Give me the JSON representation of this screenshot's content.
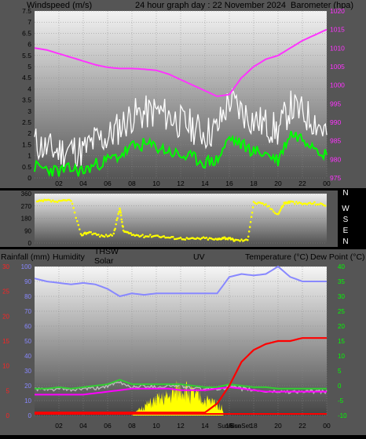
{
  "header": {
    "windspeed_label": "Windspeed (m/s)",
    "title": "24 hour graph day : 22 November 2024",
    "barometer_label": "Barometer (hpa)"
  },
  "wind_direction_labels": [
    "N",
    "W",
    "S",
    "E",
    "N"
  ],
  "bottom_header": {
    "rain_label": "Rainfall (mm)",
    "humidity_label": "Humidity",
    "thsw_label": "THSW",
    "solar_label": "Solar",
    "uv_label": "UV",
    "temp_label": "Temperature (°C)",
    "dew_label": "Dew Point (°C)"
  },
  "sunrise_label": "SunRise",
  "sunset_label": "SunSet",
  "colors": {
    "wind_gust": "#ffffff",
    "wind_avg": "#00ff00",
    "barometer": "#ff33ff",
    "direction": "#ffff00",
    "humidity": "#8888ff",
    "temperature": "#ff0000",
    "dewpoint": "#ff00ff",
    "thsw": "#bbbbbb",
    "solar": "#ffff00",
    "rain_axis": "#ff2222",
    "temp_axis": "#00ff00"
  },
  "chart_data": [
    {
      "type": "line",
      "title": "24 hour graph day : 22 November 2024",
      "xlabel": "",
      "x_ticks": [
        "02",
        "04",
        "06",
        "08",
        "10",
        "12",
        "14",
        "16",
        "18",
        "20",
        "22",
        "00"
      ],
      "ylabel_left": "Windspeed (m/s)",
      "ylim_left": [
        0,
        7.5
      ],
      "yticks_left": [
        "0",
        "0.5",
        "1",
        "1.5",
        "2",
        "2.5",
        "3",
        "3.5",
        "4",
        "4.5",
        "5",
        "5.5",
        "6",
        "6.5",
        "7",
        "7.5"
      ],
      "ylabel_right": "Barometer (hpa)",
      "ylim_right": [
        975,
        1020
      ],
      "yticks_right": [
        "975",
        "980",
        "985",
        "990",
        "995",
        "1000",
        "1005",
        "1010",
        "1015",
        "1020"
      ],
      "hours": [
        0,
        1,
        2,
        3,
        4,
        5,
        6,
        7,
        8,
        9,
        10,
        11,
        12,
        13,
        14,
        15,
        16,
        17,
        18,
        19,
        20,
        21,
        22,
        23,
        24
      ],
      "series": [
        {
          "axis": "left",
          "values": [
            1.6,
            1.3,
            1.2,
            1.3,
            1.2,
            1.7,
            1.8,
            2.3,
            2.8,
            2.9,
            3.0,
            2.8,
            2.5,
            2.3,
            2.0,
            2.2,
            3.5,
            3.0,
            2.6,
            2.4,
            2.1,
            3.2,
            2.9,
            2.6,
            2.0
          ]
        },
        {
          "axis": "left",
          "values": [
            0.5,
            0.4,
            0.3,
            0.4,
            0.3,
            0.6,
            0.8,
            1.0,
            1.4,
            1.5,
            1.4,
            1.2,
            1.0,
            0.9,
            0.7,
            0.8,
            1.8,
            1.5,
            1.2,
            1.1,
            0.8,
            2.0,
            1.8,
            1.5,
            1.0
          ]
        },
        {
          "axis": "right",
          "values": [
            1010,
            1009.5,
            1008.5,
            1007.5,
            1006.5,
            1005.5,
            1004.8,
            1004.5,
            1004.5,
            1004.3,
            1004,
            1003,
            1001.5,
            1000,
            998.5,
            997,
            997.5,
            1002,
            1005,
            1007,
            1008,
            1010,
            1012,
            1013.5,
            1015
          ]
        }
      ]
    },
    {
      "type": "scatter",
      "ylabel": "",
      "ylim": [
        0,
        360
      ],
      "yticks": [
        "0",
        "90",
        "180",
        "270",
        "360"
      ],
      "x_ticks": [
        "02",
        "04",
        "06",
        "08",
        "10",
        "12",
        "14",
        "16",
        "18",
        "20",
        "22",
        "00"
      ],
      "series": [
        {
          "values": [
            [
              0.2,
              300
            ],
            [
              1,
              310
            ],
            [
              2,
              300
            ],
            [
              3,
              315
            ],
            [
              3.8,
              60
            ],
            [
              4.5,
              80
            ],
            [
              5.5,
              50
            ],
            [
              6.5,
              60
            ],
            [
              7,
              260
            ],
            [
              7.3,
              90
            ],
            [
              8,
              60
            ],
            [
              9,
              50
            ],
            [
              10,
              55
            ],
            [
              11,
              40
            ],
            [
              12,
              35
            ],
            [
              13,
              30
            ],
            [
              14,
              35
            ],
            [
              15,
              25
            ],
            [
              15.5,
              40
            ],
            [
              16,
              30
            ],
            [
              16.5,
              20
            ],
            [
              17.5,
              20
            ],
            [
              18,
              295
            ],
            [
              19,
              280
            ],
            [
              20,
              210
            ],
            [
              20.5,
              290
            ],
            [
              21,
              300
            ],
            [
              22,
              285
            ],
            [
              23,
              290
            ],
            [
              24,
              275
            ]
          ]
        }
      ]
    },
    {
      "type": "line",
      "x_ticks": [
        "02",
        "04",
        "06",
        "08",
        "10",
        "12",
        "14",
        "16",
        "18",
        "20",
        "22",
        "00"
      ],
      "ylabel_left": "Rainfall (mm) / Humidity",
      "ylim_left": [
        0,
        100
      ],
      "yticks_left_outer": [
        "0",
        "5",
        "10",
        "15",
        "20",
        "25",
        "30"
      ],
      "yticks_left_inner": [
        "0",
        "10",
        "20",
        "30",
        "40",
        "50",
        "60",
        "70",
        "80",
        "90",
        "100"
      ],
      "ylabel_right": "Temperature (°C) / Dew Point (°C)",
      "ylim_right": [
        -10,
        40
      ],
      "yticks_right": [
        "-10",
        "-5",
        "0",
        "5",
        "10",
        "15",
        "20",
        "25",
        "30",
        "35",
        "40"
      ],
      "hours": [
        0,
        1,
        2,
        3,
        4,
        5,
        6,
        7,
        8,
        9,
        10,
        11,
        12,
        13,
        14,
        15,
        16,
        17,
        18,
        19,
        20,
        21,
        22,
        23,
        24
      ],
      "series": [
        {
          "axis": "left",
          "values": [
            92,
            90,
            89,
            88,
            89,
            88,
            85,
            80,
            82,
            81,
            82,
            82,
            82,
            82,
            82,
            82,
            93,
            95,
            94,
            95,
            100,
            93,
            90,
            90,
            90
          ]
        },
        {
          "axis": "right",
          "values": [
            -1,
            -1,
            -0.5,
            -1,
            -0.5,
            0,
            0.5,
            2,
            0.5,
            0.5,
            0.5,
            0.5,
            0.5,
            0,
            -0.5,
            -0.5,
            0.5,
            0,
            -0.5,
            -0.5,
            -1,
            -1,
            -1,
            -1,
            -1
          ]
        },
        {
          "axis": "right",
          "values": [
            -3,
            -3,
            -3,
            -3,
            -3,
            -2.5,
            -2,
            -1.5,
            -1,
            -1,
            -1,
            -1,
            -1.5,
            -1.5,
            -1.5,
            -1,
            -0.5,
            -1,
            -1.5,
            -2,
            -2,
            -2,
            -2,
            -2,
            -2
          ]
        },
        {
          "axis": "right",
          "values": [
            -9,
            -9,
            -9,
            -9,
            -9,
            -9,
            -9,
            -9,
            -9,
            -9,
            -9,
            -9,
            -9,
            -9,
            -9,
            -6,
            0,
            8,
            12,
            14,
            15,
            15,
            16,
            16,
            16
          ]
        },
        {
          "axis": "right",
          "values": [
            -1,
            -1.5,
            -1,
            -1.5,
            -1,
            -1,
            0,
            1,
            -0.5,
            0,
            -0.5,
            0,
            0,
            -1,
            -1,
            -1,
            -0.5,
            -1,
            -1.5,
            -2,
            -2,
            -2,
            -2,
            -2,
            -2
          ]
        },
        {
          "axis": "left",
          "values": [
            0,
            0,
            0,
            0,
            0,
            0,
            0,
            0,
            0,
            6,
            10,
            12,
            18,
            14,
            10,
            8,
            0,
            0,
            0,
            0,
            0,
            0,
            0,
            0,
            0
          ]
        }
      ]
    }
  ]
}
